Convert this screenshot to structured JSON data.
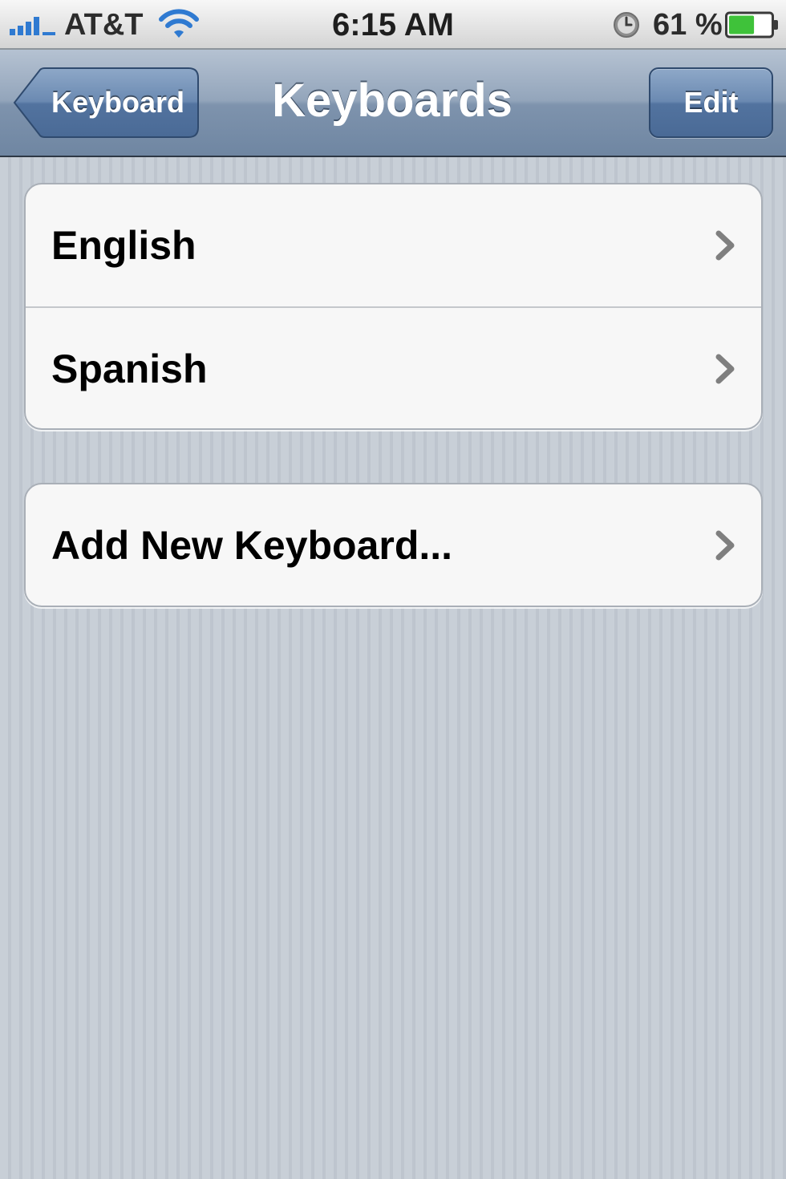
{
  "status_bar": {
    "carrier": "AT&T",
    "time": "6:15 AM",
    "battery_percent": "61 %",
    "battery_level": 0.61,
    "icons": [
      "signal-bars-icon",
      "wifi-icon",
      "clock-icon",
      "battery-icon"
    ]
  },
  "nav": {
    "back_label": "Keyboard",
    "title": "Keyboards",
    "edit_label": "Edit"
  },
  "keyboards": [
    {
      "label": "English",
      "icon": "chevron-right-icon"
    },
    {
      "label": "Spanish",
      "icon": "chevron-right-icon"
    }
  ],
  "add_keyboard": {
    "label": "Add New Keyboard...",
    "icon": "chevron-right-icon"
  },
  "colors": {
    "nav_bar": "#7e93ad",
    "signal_blue": "#2f7ad1",
    "battery_green": "#3fc23a",
    "chevron": "#7f7f7f"
  }
}
